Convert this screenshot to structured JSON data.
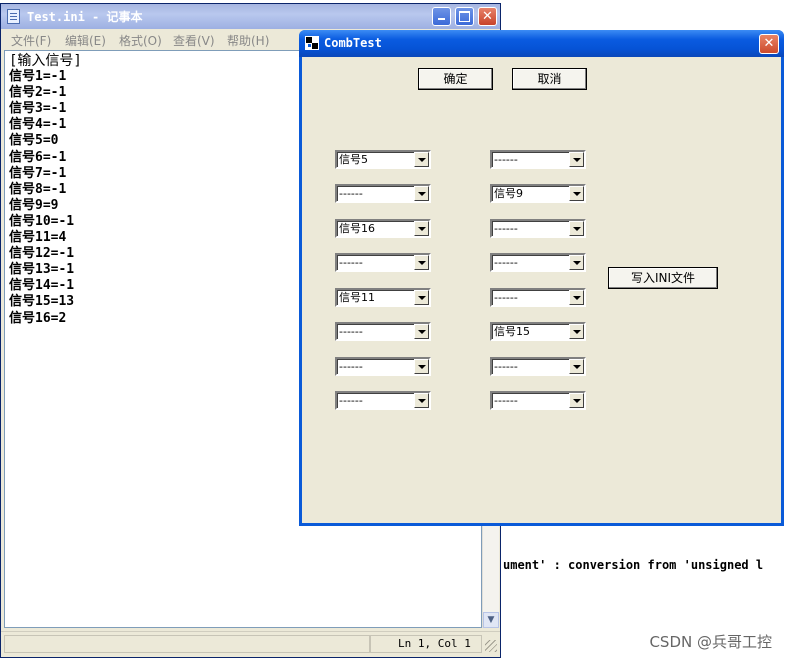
{
  "background": {
    "console_line": "ument' : conversion from 'unsigned l",
    "watermark": "CSDN @兵哥工控"
  },
  "notepad": {
    "title": "Test.ini - 记事本",
    "menu": [
      "文件(F)",
      "编辑(E)",
      "格式(O)",
      "查看(V)",
      "帮助(H)"
    ],
    "lines": [
      "[输入信号]",
      "信号1=-1",
      "信号2=-1",
      "信号3=-1",
      "信号4=-1",
      "信号5=0",
      "信号6=-1",
      "信号7=-1",
      "信号8=-1",
      "信号9=9",
      "信号10=-1",
      "信号11=4",
      "信号12=-1",
      "信号13=-1",
      "信号14=-1",
      "信号15=13",
      "信号16=2"
    ],
    "status_position": "Ln 1, Col 1",
    "scroll_down_glyph": "▼"
  },
  "dialog": {
    "title": "CombTest",
    "close_glyph": "✕",
    "ok_label": "确定",
    "cancel_label": "取消",
    "write_ini_label": "写入INI文件",
    "combos_left": [
      "信号5",
      "------",
      "信号16",
      "------",
      "信号11",
      "------",
      "------",
      "------"
    ],
    "combos_right": [
      "------",
      "信号9",
      "------",
      "------",
      "------",
      "信号15",
      "------",
      "------"
    ]
  },
  "colors": {
    "xp_titlebar_blue": "#0A5AD8",
    "dialog_face": "#ECE9D8",
    "close_red": "#C7432A"
  }
}
